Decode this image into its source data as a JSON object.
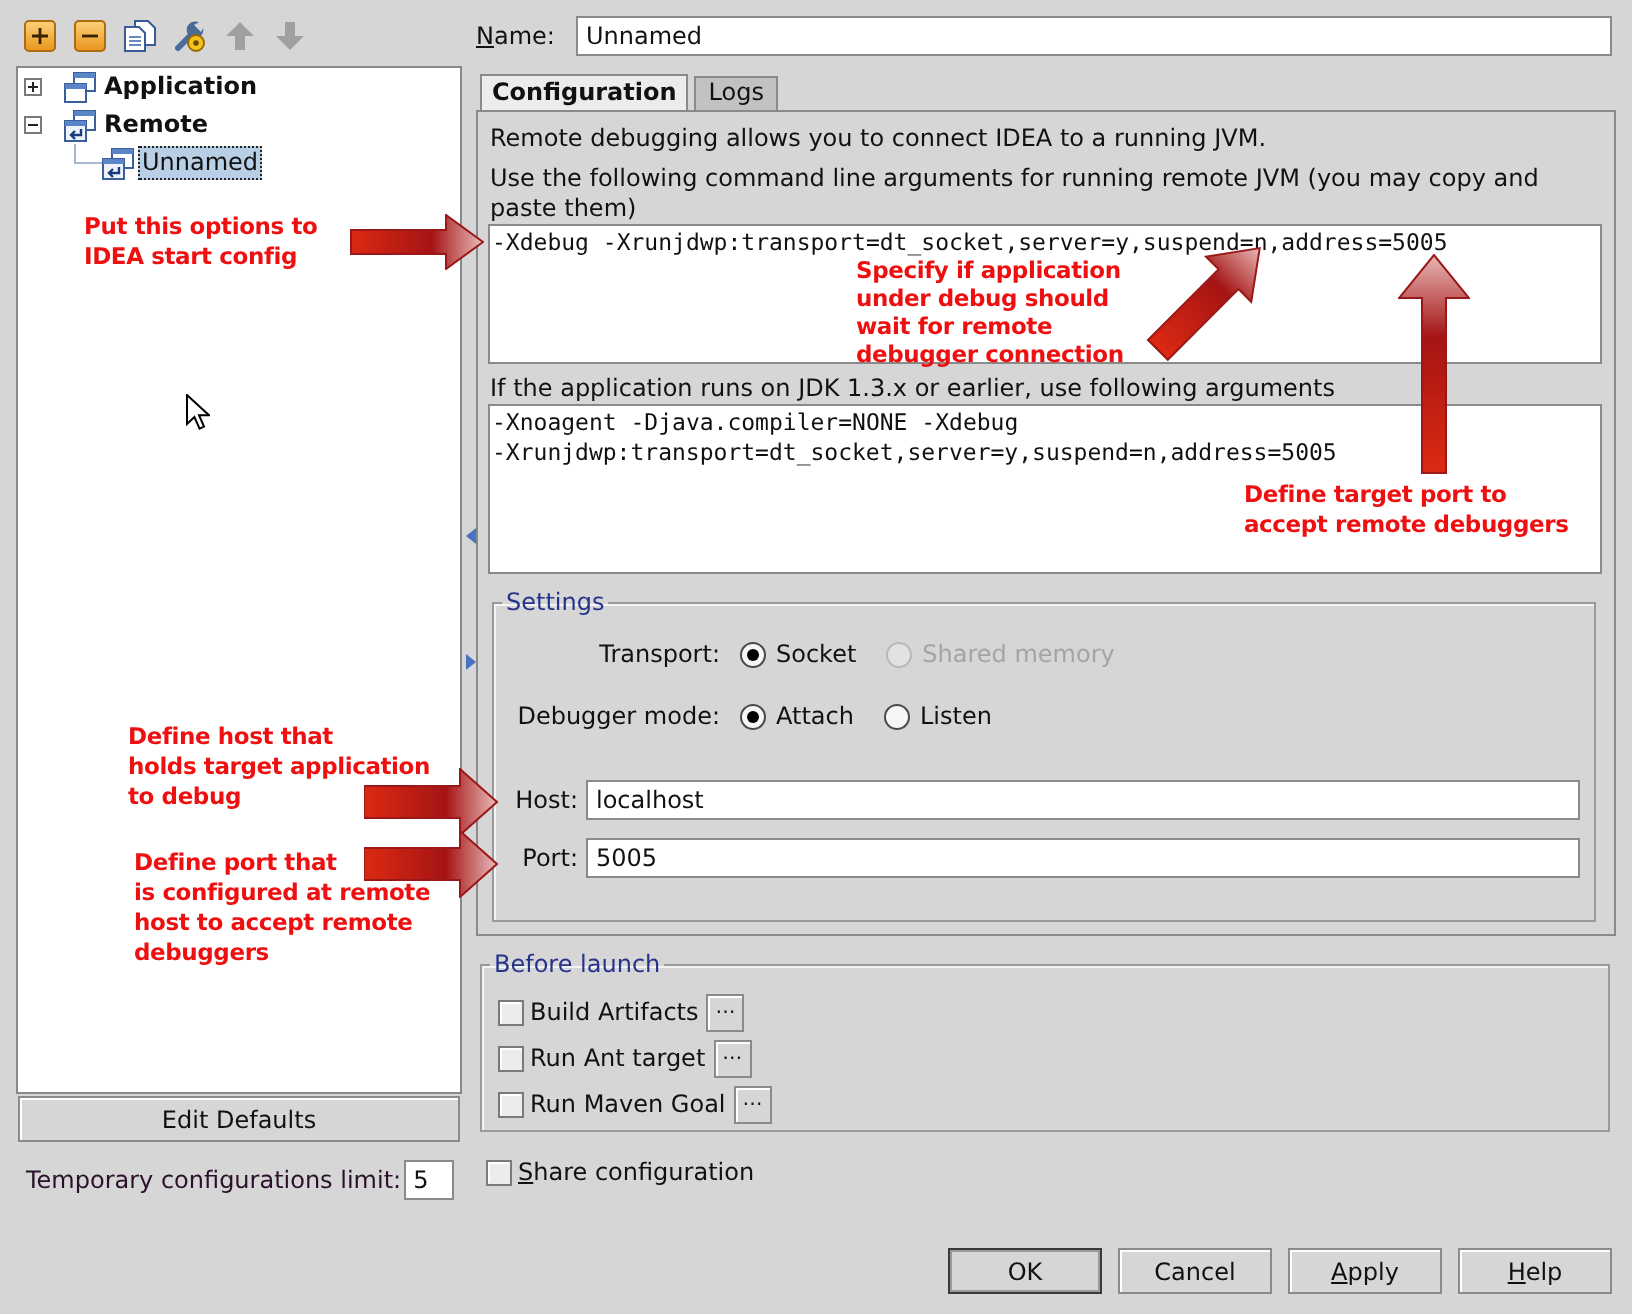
{
  "toolbar": [
    {
      "disabled": false
    },
    {
      "disabled": false
    },
    {
      "disabled": false
    },
    {
      "disabled": false
    },
    {
      "disabled": true
    },
    {
      "disabled": true
    }
  ],
  "tree": [
    {
      "label": "Application",
      "kind": "application",
      "expanded": false,
      "selected": false
    },
    {
      "label": "Remote",
      "kind": "remote",
      "expanded": true,
      "selected": false,
      "children": [
        {
          "label": "Unnamed",
          "kind": "remote",
          "selected": true
        }
      ]
    }
  ],
  "edit_defaults_button": {
    "label": "Edit Defaults"
  },
  "temporary_limit": {
    "label": "Temporary configurations limit:",
    "value": "5"
  },
  "name_field": {
    "label": "Name:",
    "mnemonic": true,
    "value": "Unnamed"
  },
  "tabs": [
    {
      "label": "Configuration",
      "selected": true
    },
    {
      "label": "Logs",
      "selected": false
    }
  ],
  "configuration": {
    "intro": "Remote debugging allows you to connect IDEA to a running JVM.",
    "arguments_label": "Use the following command line arguments for running remote JVM (you may copy and paste them)",
    "arguments": "-Xdebug -Xrunjdwp:transport=dt_socket,server=y,suspend=n,address=5005",
    "legacy_label": "If the application runs on JDK 1.3.x or earlier, use following arguments",
    "legacy_arguments": "-Xnoagent -Djava.compiler=NONE -Xdebug -Xrunjdwp:transport=dt_socket,server=y,suspend=n,address=5005",
    "settings": {
      "title": "Settings",
      "transport": {
        "label": "Transport:",
        "options": [
          {
            "label": "Socket",
            "selected": true,
            "disabled": false
          },
          {
            "label": "Shared memory",
            "selected": false,
            "disabled": true
          }
        ]
      },
      "debugger_mode": {
        "label": "Debugger mode:",
        "options": [
          {
            "label": "Attach",
            "selected": true,
            "disabled": false
          },
          {
            "label": "Listen",
            "selected": false,
            "disabled": false
          }
        ]
      },
      "host": {
        "label": "Host:",
        "value": "localhost"
      },
      "port": {
        "label": "Port:",
        "value": "5005"
      }
    }
  },
  "before_launch": {
    "title": "Before launch",
    "tasks": [
      {
        "label": "Build Artifacts",
        "checked": false,
        "button": "⋯"
      },
      {
        "label": "Run Ant target",
        "checked": false,
        "button": "⋯"
      },
      {
        "label": "Run Maven Goal",
        "checked": false,
        "button": "⋯"
      }
    ]
  },
  "share_configuration": {
    "label": "Share configuration",
    "mnemonic": true,
    "checked": false
  },
  "buttons": [
    {
      "label": "OK",
      "default": true,
      "mnemonic": false
    },
    {
      "label": "Cancel",
      "default": false,
      "mnemonic": false
    },
    {
      "label": "Apply",
      "mnemonic": true,
      "default": false
    },
    {
      "label": "Help",
      "mnemonic": true,
      "default": false
    }
  ],
  "annotations": [
    {
      "text": "Put this options to\nIDEA start config"
    },
    {
      "text": "Specify if application\nunder debug should\nwait for remote\ndebugger connection"
    },
    {
      "text": "Define target port to\naccept remote debuggers"
    },
    {
      "text": "Define host that\nholds target application\nto debug"
    },
    {
      "text": "Define port that\nis configured at remote\nhost to accept remote\ndebuggers"
    }
  ]
}
